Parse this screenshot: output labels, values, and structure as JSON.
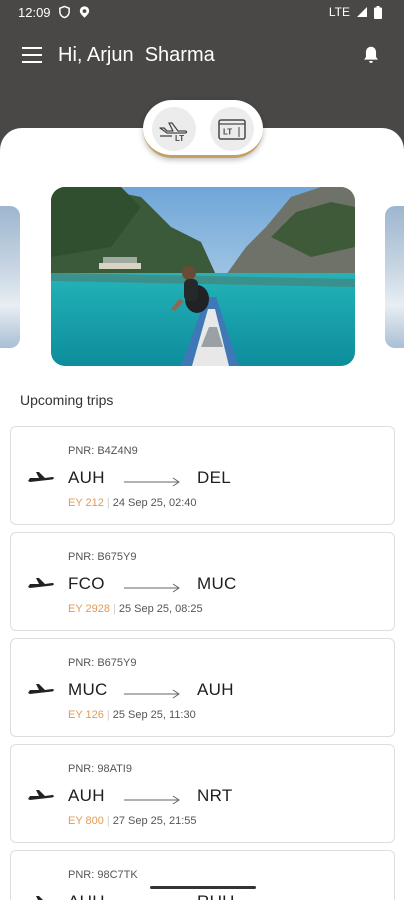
{
  "status_bar": {
    "time": "12:09",
    "network": "LTE",
    "icons": [
      "shield-icon",
      "location-icon",
      "signal-icon",
      "battery-icon"
    ]
  },
  "header": {
    "greeting": "Hi, Arjun  Sharma",
    "menu_icon": "menu-icon",
    "notification_icon": "bell-icon"
  },
  "mode_switcher": {
    "options": [
      {
        "icon": "flight-lt-icon",
        "label": "LT"
      },
      {
        "icon": "card-lt-icon",
        "label": "LT"
      }
    ]
  },
  "upcoming": {
    "title": "Upcoming trips",
    "trips": [
      {
        "pnr": "PNR: B4Z4N9",
        "from": "AUH",
        "to": "DEL",
        "flight": "EY 212",
        "datetime": "24 Sep 25, 02:40"
      },
      {
        "pnr": "PNR: B675Y9",
        "from": "FCO",
        "to": "MUC",
        "flight": "EY 2928",
        "datetime": "25 Sep 25, 08:25"
      },
      {
        "pnr": "PNR: B675Y9",
        "from": "MUC",
        "to": "AUH",
        "flight": "EY 126",
        "datetime": "25 Sep 25, 11:30"
      },
      {
        "pnr": "PNR: 98ATI9",
        "from": "AUH",
        "to": "NRT",
        "flight": "EY 800",
        "datetime": "27 Sep 25, 21:55"
      },
      {
        "pnr": "PNR: 98C7TK",
        "from": "AUH",
        "to": "RUH",
        "flight": "",
        "datetime": ""
      }
    ]
  },
  "colors": {
    "header_bg": "#4a4846",
    "accent_gold": "#c5a063",
    "flight_orange": "#e39a55"
  }
}
